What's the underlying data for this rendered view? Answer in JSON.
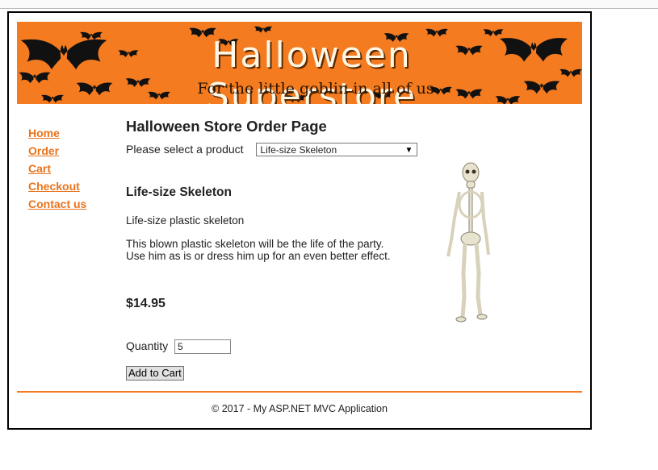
{
  "browser": {
    "top_snippet": ""
  },
  "banner": {
    "title": "Halloween Superstore",
    "subtitle": "For the little goblin in all of us",
    "bg_color": "#f47b20"
  },
  "nav": {
    "items": [
      {
        "label": "Home"
      },
      {
        "label": "Order"
      },
      {
        "label": "Cart"
      },
      {
        "label": "Checkout"
      },
      {
        "label": "Contact us"
      }
    ],
    "link_color": "#e8731c"
  },
  "main": {
    "page_title": "Halloween Store Order Page",
    "select_label": "Please select a product",
    "selected_product": "Life-size Skeleton",
    "product": {
      "name": "Life-size Skeleton",
      "short_description": "Life-size plastic skeleton",
      "long_description": "This blown plastic skeleton will be the life of the party. Use him as is or dress him up for an even better effect.",
      "price": "$14.95",
      "image_icon": "skeleton-icon"
    },
    "quantity_label": "Quantity",
    "quantity_value": "5",
    "add_button_label": "Add to Cart"
  },
  "footer": {
    "text": "© 2017 - My ASP.NET MVC Application"
  }
}
